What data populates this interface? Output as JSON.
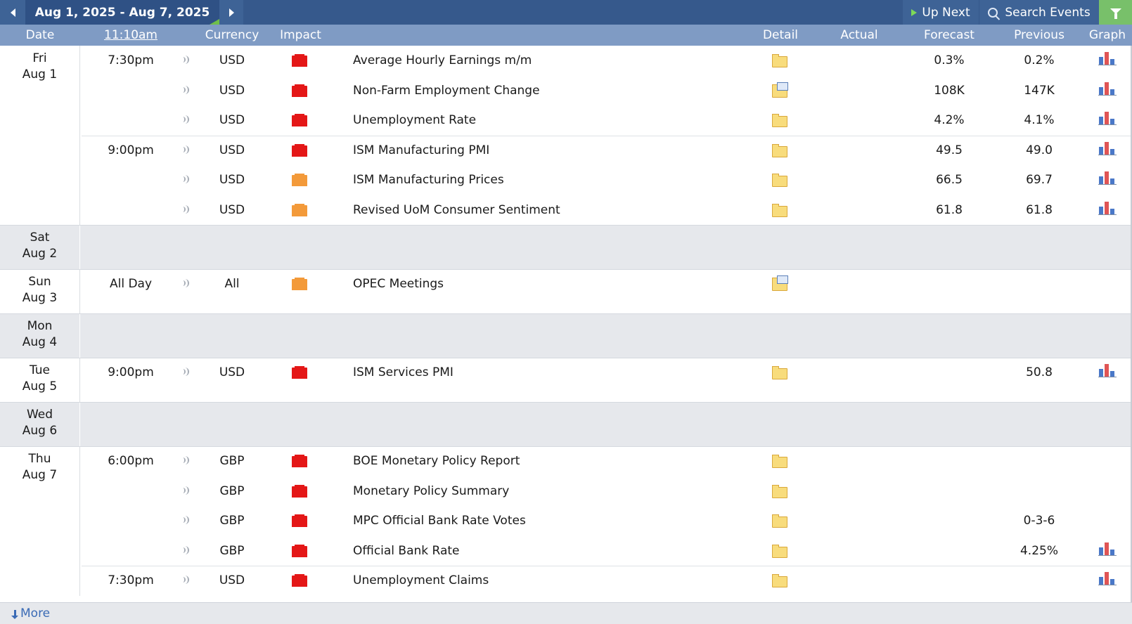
{
  "toolbar": {
    "date_range": "Aug 1, 2025 - Aug 7, 2025",
    "up_next": "Up Next",
    "search_events": "Search Events"
  },
  "columns": {
    "date": "Date",
    "time": "11:10am",
    "currency": "Currency",
    "impact": "Impact",
    "detail": "Detail",
    "actual": "Actual",
    "forecast": "Forecast",
    "previous": "Previous",
    "graph": "Graph"
  },
  "days": [
    {
      "weekday": "Fri",
      "date": "Aug 1",
      "events": [
        {
          "time": "7:30pm",
          "currency": "USD",
          "impact": "high",
          "event": "Average Hourly Earnings m/m",
          "detail": "folder",
          "actual": "",
          "forecast": "0.3%",
          "previous": "0.2%",
          "graph": true
        },
        {
          "time": "",
          "currency": "USD",
          "impact": "high",
          "event": "Non-Farm Employment Change",
          "detail": "news",
          "actual": "",
          "forecast": "108K",
          "previous": "147K",
          "graph": true
        },
        {
          "time": "",
          "currency": "USD",
          "impact": "high",
          "event": "Unemployment Rate",
          "detail": "folder",
          "actual": "",
          "forecast": "4.2%",
          "previous": "4.1%",
          "graph": true
        },
        {
          "time": "9:00pm",
          "currency": "USD",
          "impact": "high",
          "event": "ISM Manufacturing PMI",
          "detail": "folder",
          "actual": "",
          "forecast": "49.5",
          "previous": "49.0",
          "graph": true
        },
        {
          "time": "",
          "currency": "USD",
          "impact": "medium",
          "event": "ISM Manufacturing Prices",
          "detail": "folder",
          "actual": "",
          "forecast": "66.5",
          "previous": "69.7",
          "graph": true
        },
        {
          "time": "",
          "currency": "USD",
          "impact": "medium",
          "event": "Revised UoM Consumer Sentiment",
          "detail": "folder",
          "actual": "",
          "forecast": "61.8",
          "previous": "61.8",
          "graph": true
        }
      ]
    },
    {
      "weekday": "Sat",
      "date": "Aug 2",
      "events": []
    },
    {
      "weekday": "Sun",
      "date": "Aug 3",
      "events": [
        {
          "time": "All Day",
          "currency": "All",
          "impact": "medium",
          "event": "OPEC Meetings",
          "detail": "news",
          "actual": "",
          "forecast": "",
          "previous": "",
          "graph": false
        }
      ]
    },
    {
      "weekday": "Mon",
      "date": "Aug 4",
      "events": []
    },
    {
      "weekday": "Tue",
      "date": "Aug 5",
      "events": [
        {
          "time": "9:00pm",
          "currency": "USD",
          "impact": "high",
          "event": "ISM Services PMI",
          "detail": "folder",
          "actual": "",
          "forecast": "",
          "previous": "50.8",
          "graph": true
        }
      ]
    },
    {
      "weekday": "Wed",
      "date": "Aug 6",
      "events": []
    },
    {
      "weekday": "Thu",
      "date": "Aug 7",
      "events": [
        {
          "time": "6:00pm",
          "currency": "GBP",
          "impact": "high",
          "event": "BOE Monetary Policy Report",
          "detail": "folder",
          "actual": "",
          "forecast": "",
          "previous": "",
          "graph": false
        },
        {
          "time": "",
          "currency": "GBP",
          "impact": "high",
          "event": "Monetary Policy Summary",
          "detail": "folder",
          "actual": "",
          "forecast": "",
          "previous": "",
          "graph": false
        },
        {
          "time": "",
          "currency": "GBP",
          "impact": "high",
          "event": "MPC Official Bank Rate Votes",
          "detail": "folder",
          "actual": "",
          "forecast": "",
          "previous": "0-3-6",
          "graph": false
        },
        {
          "time": "",
          "currency": "GBP",
          "impact": "high",
          "event": "Official Bank Rate",
          "detail": "folder",
          "actual": "",
          "forecast": "",
          "previous": "4.25%",
          "graph": true
        },
        {
          "time": "7:30pm",
          "currency": "USD",
          "impact": "high",
          "event": "Unemployment Claims",
          "detail": "folder",
          "actual": "",
          "forecast": "",
          "previous": "",
          "graph": true
        }
      ]
    }
  ],
  "footer": {
    "more": "More"
  },
  "colors": {
    "accent": "#36598c",
    "header": "#7f9bc4",
    "impact_high": "#e41717",
    "impact_medium": "#f39a3a",
    "filter": "#78c06a"
  }
}
